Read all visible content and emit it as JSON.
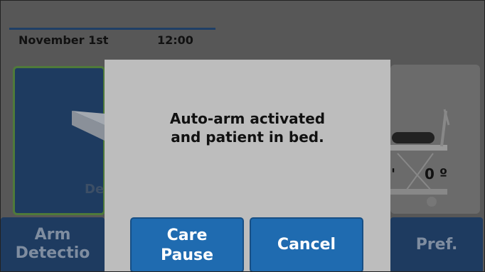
{
  "header": {
    "date": "November 1st",
    "time": "12:00"
  },
  "background": {
    "left_tile_label_fragment": "De",
    "right_tile_angle": "0 º",
    "right_tile_angle_tick": "'",
    "nav_arm_line1": "Arm",
    "nav_arm_line2": "Detectio",
    "nav_pref": "Pref."
  },
  "dialog": {
    "message_line1": "Auto-arm activated",
    "message_line2": "and patient in bed.",
    "care_pause_line1": "Care",
    "care_pause_line2": "Pause",
    "cancel_label": "Cancel"
  },
  "colors": {
    "dialog_bg": "#bdbdbd",
    "button_blue": "#1f6bb0",
    "nav_blue": "#1e3b60"
  }
}
